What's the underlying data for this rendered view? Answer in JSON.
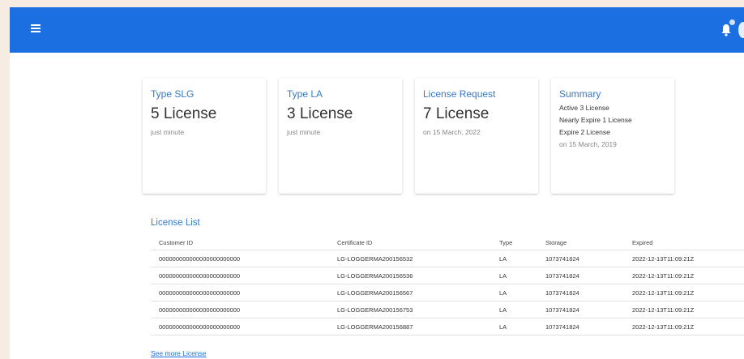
{
  "topbar": {
    "color": "#1c6fe0",
    "menu_icon": "hamburger-icon",
    "notification_icon": "bell-icon"
  },
  "cards": [
    {
      "title": "Type SLG",
      "value": "5 License",
      "sub": "just minute"
    },
    {
      "title": "Type LA",
      "value": "3 License",
      "sub": "just minute"
    },
    {
      "title": "License Request",
      "value": "7 License",
      "sub": "on 15 March, 2022"
    }
  ],
  "summary": {
    "title": "Summary",
    "lines": [
      "Active 3 License",
      "Nearly Expire 1 License",
      "Expire 2 License"
    ],
    "date": "on 15 March, 2019"
  },
  "license_list": {
    "title": "License List",
    "columns": [
      "Customer ID",
      "Certificate ID",
      "Type",
      "Storage",
      "Expired"
    ],
    "rows": [
      [
        "000000000000000000000000",
        "LG-LOGGERMA200156532",
        "LA",
        "1073741824",
        "2022-12-13T11:09:21Z"
      ],
      [
        "000000000000000000000000",
        "LG-LOGGERMA200156536",
        "LA",
        "1073741824",
        "2022-12-13T11:09:21Z"
      ],
      [
        "000000000000000000000000",
        "LG-LOGGERMA200156567",
        "LA",
        "1073741824",
        "2022-12-13T11:09:21Z"
      ],
      [
        "000000000000000000000000",
        "LG-LOGGERMA200156753",
        "LA",
        "1073741824",
        "2022-12-13T11:09:21Z"
      ],
      [
        "000000000000000000000000",
        "LG-LOGGERMA200156887",
        "LA",
        "1073741824",
        "2022-12-13T11:09:21Z"
      ]
    ],
    "see_more": "See more License"
  }
}
